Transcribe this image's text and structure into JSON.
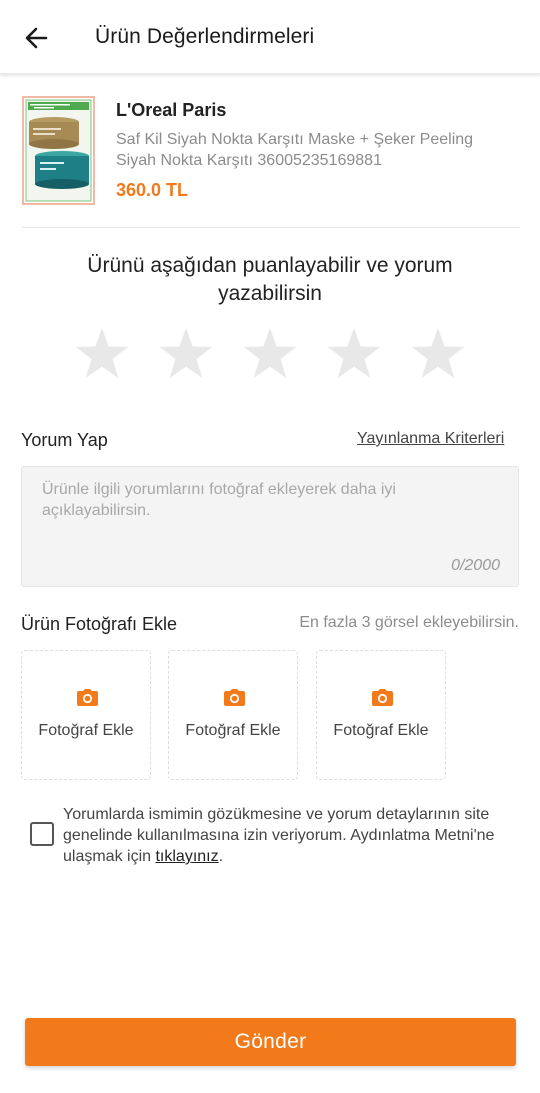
{
  "header": {
    "title": "Ürün Değerlendirmeleri",
    "back_icon": "arrow-left-icon"
  },
  "product": {
    "brand": "L'Oreal Paris",
    "name": "Saf Kil Siyah Nokta Karşıtı Maske + Şeker Peeling Siyah Nokta Karşıtı 36005235169881",
    "price": "360.0 TL",
    "image_label": "product-thumbnail"
  },
  "rating": {
    "prompt": "Ürünü aşağıdan puanlayabilir ve yorum yazabilirsin",
    "max_stars": 5,
    "selected_stars": 0,
    "star_empty_color": "#e8e8e8"
  },
  "review": {
    "label": "Yorum Yap",
    "criteria_link": "Yayınlanma Kriterleri",
    "placeholder": "Ürünle ilgili yorumlarını fotoğraf ekleyerek daha iyi açıklayabilirsin.",
    "value": "",
    "counter": "0/2000"
  },
  "photos": {
    "label": "Ürün Fotoğrafı Ekle",
    "hint": "En fazla 3 görsel ekleyebilirsin.",
    "slots": [
      {
        "label": "Fotoğraf Ekle",
        "icon": "camera-icon"
      },
      {
        "label": "Fotoğraf Ekle",
        "icon": "camera-icon"
      },
      {
        "label": "Fotoğraf Ekle",
        "icon": "camera-icon"
      }
    ]
  },
  "consent": {
    "checked": false,
    "text": "Yorumlarda ismimin gözükmesine ve yorum detaylarının site genelinde kullanılmasına izin veriyorum. Aydınlatma Metni'ne ulaşmak için ",
    "link": "tıklayınız",
    "suffix": "."
  },
  "submit": {
    "label": "Gönder"
  },
  "colors": {
    "accent": "#f27a1a",
    "text_primary": "#222222",
    "text_muted": "#8c8c8c",
    "input_bg": "#f4f4f4"
  }
}
